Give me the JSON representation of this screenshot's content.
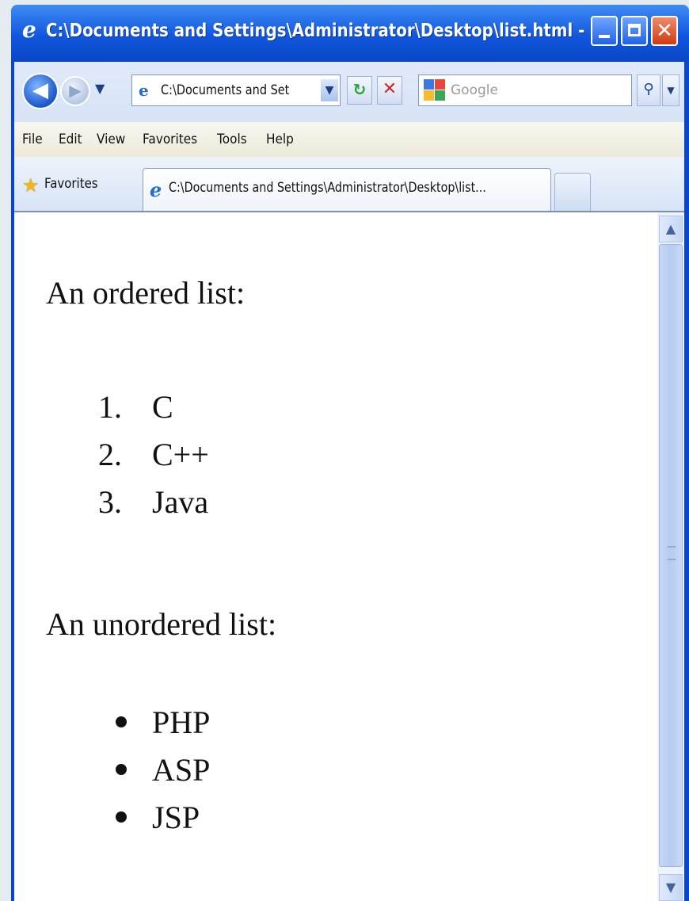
{
  "window": {
    "title": "C:\\Documents and Settings\\Administrator\\Desktop\\list.html - ..."
  },
  "toolbar": {
    "address": "C:\\Documents and Set",
    "search_placeholder": "Google"
  },
  "menu": [
    "File",
    "Edit",
    "View",
    "Favorites",
    "Tools",
    "Help"
  ],
  "favorites_label": "Favorites",
  "tab": {
    "label": "C:\\Documents and Settings\\Administrator\\Desktop\\list..."
  },
  "content": {
    "ordered_heading": "An ordered list:",
    "ordered_items": [
      {
        "marker": "1.",
        "text": "C"
      },
      {
        "marker": "2.",
        "text": "C++"
      },
      {
        "marker": "3.",
        "text": "Java"
      }
    ],
    "unordered_heading": "An unordered list:",
    "unordered_items": [
      "PHP",
      "ASP",
      "JSP"
    ]
  },
  "colors": {
    "titlebar": "#1157de",
    "close_button": "#cf3b14",
    "google_blue": "#3b78e7",
    "google_red": "#e8453c",
    "google_yellow": "#f9bb2d",
    "google_green": "#3aa757"
  },
  "icons": [
    "ie-icon",
    "back-arrow-icon",
    "forward-arrow-icon",
    "page-icon",
    "refresh-icon",
    "stop-icon",
    "google-icon",
    "search-icon",
    "star-icon"
  ]
}
